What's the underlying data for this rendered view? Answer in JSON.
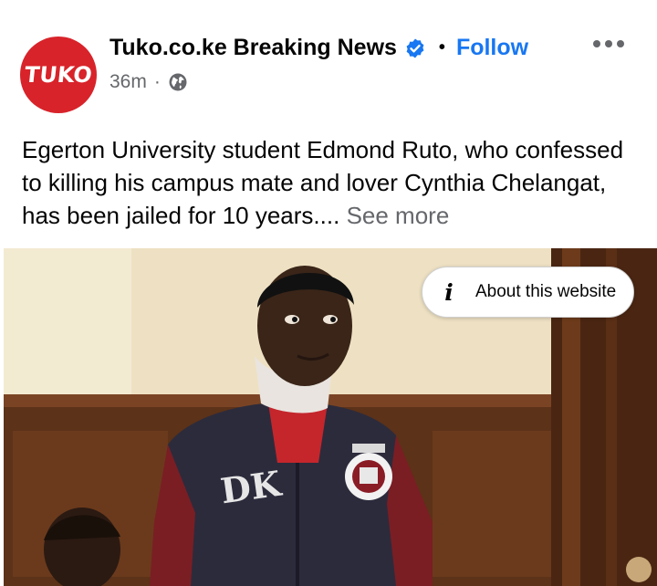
{
  "post": {
    "page": {
      "avatar_text": "TUKO",
      "name": "Tuko.co.ke Breaking News",
      "verified": true,
      "follow_label": "Follow",
      "separator": "•"
    },
    "meta": {
      "time": "36m",
      "separator": "·",
      "audience_icon": "globe-icon"
    },
    "text": "Egerton University student Edmond Ruto, who confessed to killing his campus mate and lover Cynthia Chelangat, has been jailed for 10 years....",
    "see_more_label": "See more",
    "link_preview": {
      "image_icon": "photo-of-man-in-court",
      "jacket_lettering": "DK",
      "about_label": "About this website",
      "about_icon": "info-icon"
    },
    "colors": {
      "brand_red": "#d8232a",
      "facebook_blue": "#1877f2",
      "secondary_text": "#65676b"
    }
  }
}
